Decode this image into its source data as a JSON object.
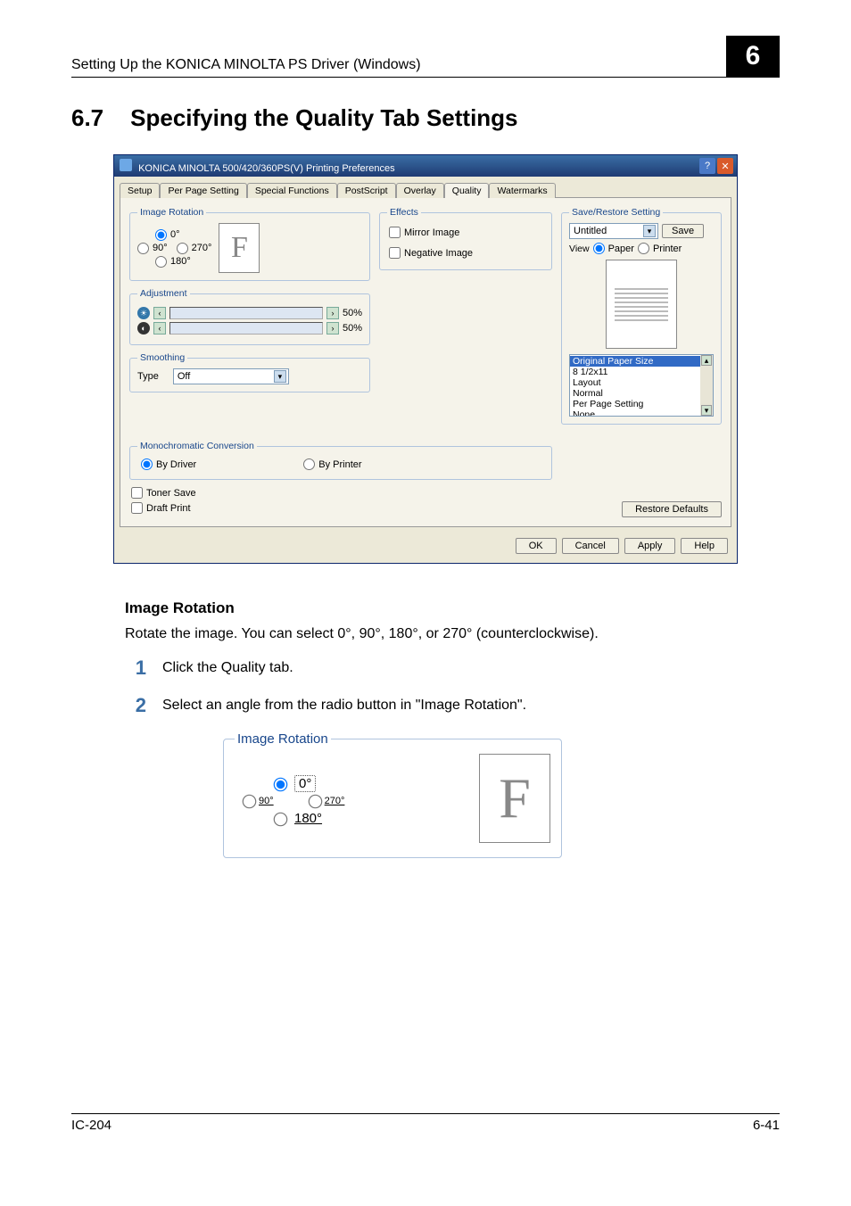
{
  "running_header": "Setting Up the KONICA MINOLTA PS Driver (Windows)",
  "chapter_number": "6",
  "section_number": "6.7",
  "section_title": "Specifying the Quality Tab Settings",
  "dialog": {
    "title": "KONICA MINOLTA 500/420/360PS(V) Printing Preferences",
    "tabs": [
      "Setup",
      "Per Page Setting",
      "Special Functions",
      "PostScript",
      "Overlay",
      "Quality",
      "Watermarks"
    ],
    "active_tab": "Quality",
    "image_rotation": {
      "legend": "Image Rotation",
      "options": {
        "deg0": "0°",
        "deg90": "90°",
        "deg180": "180°",
        "deg270": "270°"
      },
      "selected": "deg0",
      "preview_letter": "F"
    },
    "adjustment": {
      "legend": "Adjustment",
      "brightness": "50%",
      "contrast": "50%"
    },
    "smoothing": {
      "legend": "Smoothing",
      "type_label": "Type",
      "type_value": "Off"
    },
    "mono": {
      "legend": "Monochromatic Conversion",
      "by_driver": "By Driver",
      "by_printer": "By Printer",
      "selected": "by_driver"
    },
    "toner_save": "Toner Save",
    "draft_print": "Draft Print",
    "effects": {
      "legend": "Effects",
      "mirror": "Mirror Image",
      "negative": "Negative Image"
    },
    "save_restore": {
      "legend": "Save/Restore Setting",
      "name": "Untitled",
      "save": "Save",
      "view_label": "View",
      "view_paper": "Paper",
      "view_printer": "Printer",
      "list_header": "Original Paper Size",
      "list": [
        "8 1/2x11",
        "Layout",
        "Normal",
        "Per Page Setting",
        "None"
      ]
    },
    "restore_defaults": "Restore Defaults",
    "buttons": {
      "ok": "OK",
      "cancel": "Cancel",
      "apply": "Apply",
      "help": "Help"
    }
  },
  "subheading": "Image Rotation",
  "paragraph": "Rotate the image. You can select 0°, 90°, 180°, or 270° (counterclockwise).",
  "step1": "Click the Quality tab.",
  "step2": "Select an angle from the radio button in \"Image Rotation\".",
  "zoom_fig": {
    "legend": "Image Rotation",
    "deg0": "0°",
    "deg90": "90°",
    "deg180": "180°",
    "deg270": "270°",
    "preview_letter": "F"
  },
  "footer_left": "IC-204",
  "footer_right": "6-41"
}
